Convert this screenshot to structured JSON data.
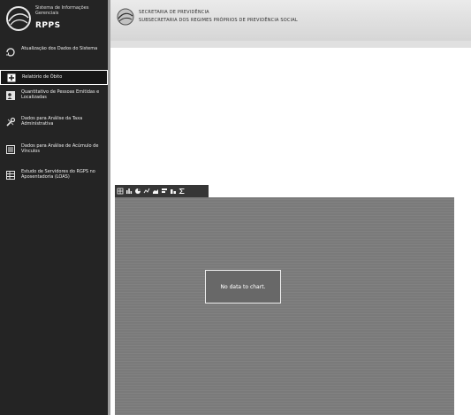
{
  "sidebar": {
    "brand_subtitle": "Sistema de Informações Gerenciais",
    "brand_title": "RPPS",
    "items": [
      {
        "label": "Atualização dos Dados do Sistema",
        "icon": "refresh-icon"
      },
      {
        "label": "Relatório de Óbito",
        "icon": "document-plus-icon"
      },
      {
        "label": "Quantitativo de Pessoas Emitidas e Localizadas",
        "icon": "users-icon"
      },
      {
        "label": "Dados para Análise da Taxa Administrativa",
        "icon": "tools-icon"
      },
      {
        "label": "Dados para Análise de Acúmulo de Vínculos",
        "icon": "list-icon"
      },
      {
        "label": "Estudo de Servidores do RGPS no Aposentadoria (LOAS)",
        "icon": "table-icon"
      }
    ]
  },
  "header": {
    "line1": "SECRETARIA DE PREVIDÊNCIA",
    "line2": "SUBSECRETARIA DOS REGIMES PRÓPRIOS DE PREVIDÊNCIA SOCIAL"
  },
  "toolbar": {
    "icons": [
      "grid-icon",
      "bar-chart-icon",
      "pie-chart-icon",
      "line-chart-icon",
      "area-chart-icon",
      "stacked-bar-icon",
      "column-chart-icon",
      "sigma-icon"
    ]
  },
  "chart": {
    "message": "No data to chart."
  }
}
